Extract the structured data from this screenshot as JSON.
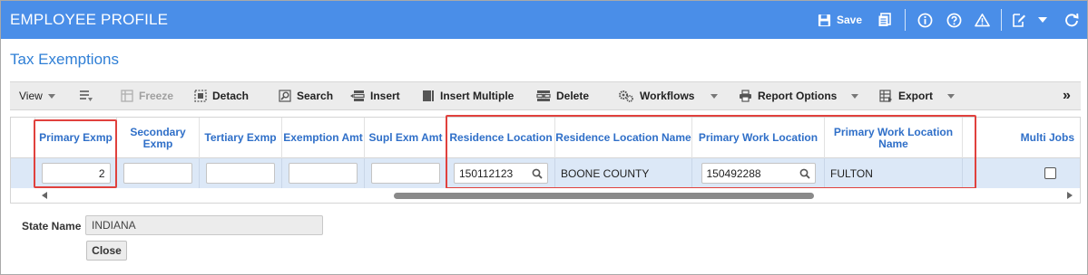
{
  "header": {
    "title": "EMPLOYEE PROFILE",
    "save_label": "Save",
    "bg_color": "#4a8ee8",
    "icons": [
      "save-icon",
      "report-icon",
      "info-icon",
      "help-icon",
      "warning-icon",
      "edit-icon",
      "dropdown-icon",
      "refresh-icon"
    ]
  },
  "section": {
    "title": "Tax Exemptions"
  },
  "toolbar": {
    "view": "View",
    "freeze": "Freeze",
    "detach": "Detach",
    "search": "Search",
    "insert": "Insert",
    "insert_multiple": "Insert Multiple",
    "delete": "Delete",
    "workflows": "Workflows",
    "report_options": "Report Options",
    "export": "Export",
    "more": "»"
  },
  "grid": {
    "columns": {
      "primary_exmp": "Primary Exmp",
      "secondary_exmp": "Secondary Exmp",
      "tertiary_exmp": "Tertiary Exmp",
      "exemption_amt": "Exemption Amt",
      "supl_exm_amt": "Supl Exm Amt",
      "residence_location": "Residence Location",
      "residence_location_name": "Residence Location Name",
      "primary_work_location": "Primary Work Location",
      "primary_work_location_name": "Primary Work Location Name",
      "multi_jobs": "Multi Jobs"
    },
    "row": {
      "primary_exmp": "2",
      "secondary_exmp": "",
      "tertiary_exmp": "",
      "exemption_amt": "",
      "supl_exm_amt": "",
      "residence_location": "150112123",
      "residence_location_name": "BOONE COUNTY",
      "primary_work_location": "150492288",
      "primary_work_location_name": "FULTON",
      "multi_jobs": false
    },
    "highlight_color": "#e0413d",
    "row_color": "#dce8f7"
  },
  "form": {
    "state_name_label": "State Name",
    "state_name_value": "INDIANA",
    "close_label": "Close"
  }
}
